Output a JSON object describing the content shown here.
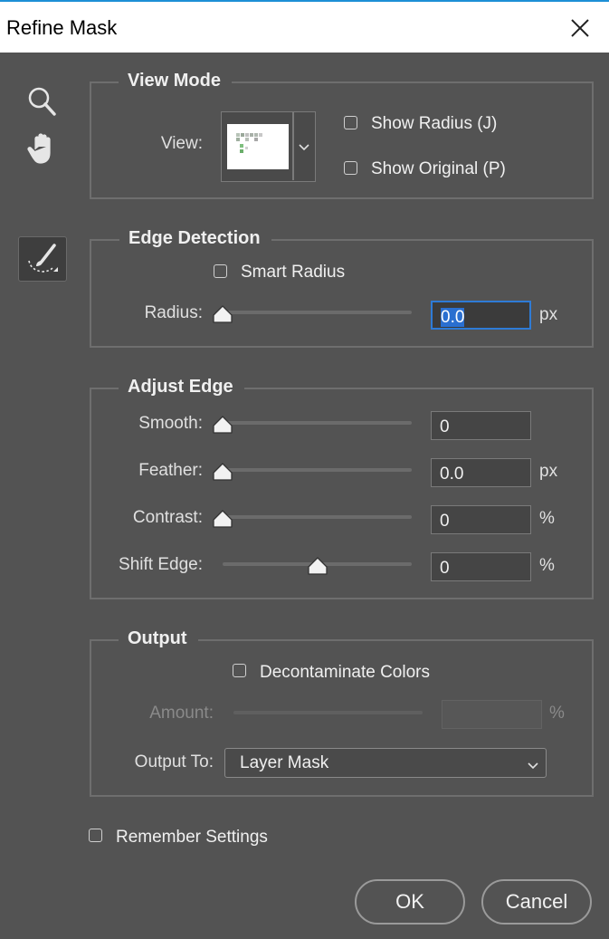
{
  "window": {
    "title": "Refine Mask"
  },
  "tools": {
    "zoom_icon": "zoom-magnifier",
    "hand_icon": "hand",
    "brush_icon": "refine-radius-brush"
  },
  "view_mode": {
    "legend": "View Mode",
    "view_label": "View:",
    "show_radius": {
      "label": "Show Radius (J)",
      "checked": false
    },
    "show_original": {
      "label": "Show Original (P)",
      "checked": false
    }
  },
  "edge_detection": {
    "legend": "Edge Detection",
    "smart_radius": {
      "label": "Smart Radius",
      "checked": false
    },
    "radius": {
      "label": "Radius:",
      "value": "0.0",
      "unit": "px",
      "slider_fraction": 0
    }
  },
  "adjust_edge": {
    "legend": "Adjust Edge",
    "smooth": {
      "label": "Smooth:",
      "value": "0",
      "slider_fraction": 0
    },
    "feather": {
      "label": "Feather:",
      "value": "0.0",
      "unit": "px",
      "slider_fraction": 0
    },
    "contrast": {
      "label": "Contrast:",
      "value": "0",
      "unit": "%",
      "slider_fraction": 0
    },
    "shift_edge": {
      "label": "Shift Edge:",
      "value": "0",
      "unit": "%",
      "slider_fraction": 0.5
    }
  },
  "output": {
    "legend": "Output",
    "decontaminate": {
      "label": "Decontaminate Colors",
      "checked": false
    },
    "amount": {
      "label": "Amount:",
      "value": "",
      "unit": "%",
      "enabled": false
    },
    "output_to": {
      "label": "Output To:",
      "value": "Layer Mask"
    }
  },
  "remember_settings": {
    "label": "Remember Settings",
    "checked": false
  },
  "buttons": {
    "ok": "OK",
    "cancel": "Cancel"
  },
  "colors": {
    "background": "#535353",
    "focus": "#2e7bd6",
    "titlebar": "#ffffff"
  }
}
